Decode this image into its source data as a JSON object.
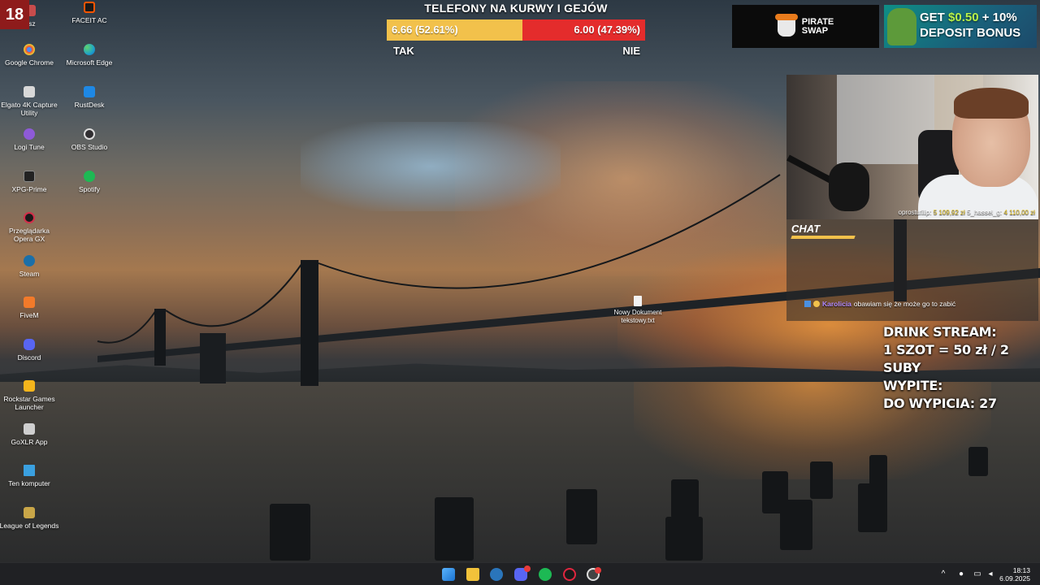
{
  "desktop": {
    "age_badge": "18",
    "icons_col1": [
      {
        "label": "asz",
        "icon": "app-icon",
        "color": "#c84c4c"
      },
      {
        "label": "Google Chrome",
        "icon": "chrome-icon",
        "color": "#e8453c"
      },
      {
        "label": "Elgato 4K Capture Utility",
        "icon": "elgato-icon",
        "color": "#d8d8d8"
      },
      {
        "label": "Logi Tune",
        "icon": "logi-icon",
        "color": "#8e5ad8"
      },
      {
        "label": "XPG-Prime",
        "icon": "xpg-icon",
        "color": "#222222"
      },
      {
        "label": "Przeglądarka Opera GX",
        "icon": "opera-gx-icon",
        "color": "#d32f4a"
      },
      {
        "label": "Steam",
        "icon": "steam-icon",
        "color": "#1b6fa8"
      },
      {
        "label": "FiveM",
        "icon": "fivem-icon",
        "color": "#f27a2a"
      },
      {
        "label": "Discord",
        "icon": "discord-icon",
        "color": "#5865f2"
      },
      {
        "label": "Rockstar Games Launcher",
        "icon": "rockstar-icon",
        "color": "#f4b51c"
      },
      {
        "label": "GoXLR App",
        "icon": "goxlr-icon",
        "color": "#cfcfcf"
      },
      {
        "label": "Ten komputer",
        "icon": "computer-icon",
        "color": "#3aa0e0"
      },
      {
        "label": "League of Legends",
        "icon": "lol-icon",
        "color": "#c9a648"
      }
    ],
    "icons_col2": [
      {
        "label": "FACEIT AC",
        "icon": "faceit-icon",
        "color": "#ff5500"
      },
      {
        "label": "Microsoft Edge",
        "icon": "edge-icon",
        "color": "#1fa3c8"
      },
      {
        "label": "RustDesk",
        "icon": "rustdesk-icon",
        "color": "#1e88e5"
      },
      {
        "label": "OBS Studio",
        "icon": "obs-icon",
        "color": "#302e31"
      },
      {
        "label": "Spotify",
        "icon": "spotify-icon",
        "color": "#1db954"
      }
    ],
    "file": {
      "label": "Nowy Dokument tekstowy.txt",
      "icon": "text-file-icon"
    }
  },
  "poll": {
    "title": "TELEFONY NA KURWY I GEJÓW",
    "yes_value": "6.66 (52.61%)",
    "no_value": "6.00 (47.39%)",
    "yes_share": 0.5261,
    "yes_label": "TAK",
    "no_label": "NIE",
    "colors": {
      "yes": "#f2c14b",
      "no": "#e42c2c"
    }
  },
  "ads": {
    "pirate_line1": "PIRATE",
    "pirate_line2": "SWAP",
    "bonus_line1_a": "GET ",
    "bonus_line1_b": "$0.50",
    "bonus_line1_c": " + 10%",
    "bonus_line2": "DEPOSIT BONUS"
  },
  "webcam": {
    "donor1": "oprostufilip:",
    "donor1_amount": "5 109,92 zł",
    "donor2": "5_hassel_g:",
    "donor2_amount": "4 110,00 zł"
  },
  "chat": {
    "title": "CHAT",
    "message_user": "Karolicia",
    "message_text": "obawiam się że może go to zabić"
  },
  "drink": {
    "line1": "DRINK STREAM:",
    "line2": "1 SZOT = 50 zł / 2 SUBY",
    "line3": "WYPITE:",
    "line4": "DO WYPICIA: 27"
  },
  "taskbar": {
    "apps": [
      {
        "name": "start-button",
        "icon": "windows-icon",
        "color": "#3b9cf0"
      },
      {
        "name": "file-explorer-button",
        "icon": "folder-icon",
        "color": "#f2c23a"
      },
      {
        "name": "steam-taskbar-button",
        "icon": "steam-icon",
        "color": "#2a75bb"
      },
      {
        "name": "discord-taskbar-button",
        "icon": "discord-icon",
        "color": "#5865f2"
      },
      {
        "name": "spotify-taskbar-button",
        "icon": "spotify-icon",
        "color": "#1db954"
      },
      {
        "name": "opera-taskbar-button",
        "icon": "opera-icon",
        "color": "#e0263f"
      },
      {
        "name": "obs-taskbar-button",
        "icon": "obs-icon",
        "color": "#555555"
      }
    ],
    "time": "18:13",
    "date": "6.09.2025"
  }
}
